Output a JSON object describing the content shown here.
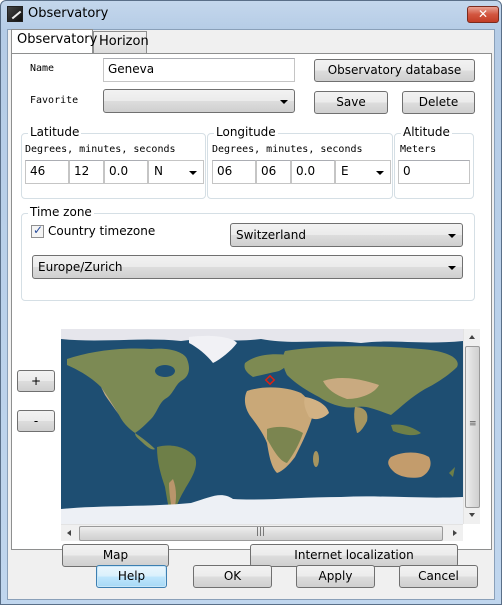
{
  "window": {
    "title": "Observatory",
    "close_label": "✕"
  },
  "tabs": [
    {
      "label": "Observatory",
      "active": true
    },
    {
      "label": "Horizon",
      "active": false
    }
  ],
  "observatory": {
    "name_label": "Name",
    "name_value": "Geneva",
    "database_button": "Observatory database",
    "favorite_label": "Favorite",
    "favorite_value": "",
    "save_button": "Save",
    "delete_button": "Delete"
  },
  "latitude": {
    "title": "Latitude",
    "hint": "Degrees, minutes, seconds",
    "degrees": "46",
    "minutes": "12",
    "seconds": "0.0",
    "hemisphere": "N"
  },
  "longitude": {
    "title": "Longitude",
    "hint": "Degrees, minutes, seconds",
    "degrees": "06",
    "minutes": "06",
    "seconds": "0.0",
    "hemisphere": "E"
  },
  "altitude": {
    "title": "Altitude",
    "hint": "Meters",
    "value": "0"
  },
  "timezone": {
    "title": "Time zone",
    "country_checkbox_label": "Country timezone",
    "country_checked": true,
    "country_value": "Switzerland",
    "zone_value": "Europe/Zurich"
  },
  "map": {
    "zoom_in_label": "+",
    "zoom_out_label": "-",
    "map_button": "Map",
    "internet_button": "Internet localization",
    "marker_location": "Geneva",
    "colors": {
      "ocean": "#1f4f73",
      "land": "#7d8a52",
      "desert": "#c9a878",
      "ice": "#eef0f4",
      "marker": "#e02010"
    }
  },
  "footer": {
    "help": "Help",
    "ok": "OK",
    "apply": "Apply",
    "cancel": "Cancel"
  }
}
